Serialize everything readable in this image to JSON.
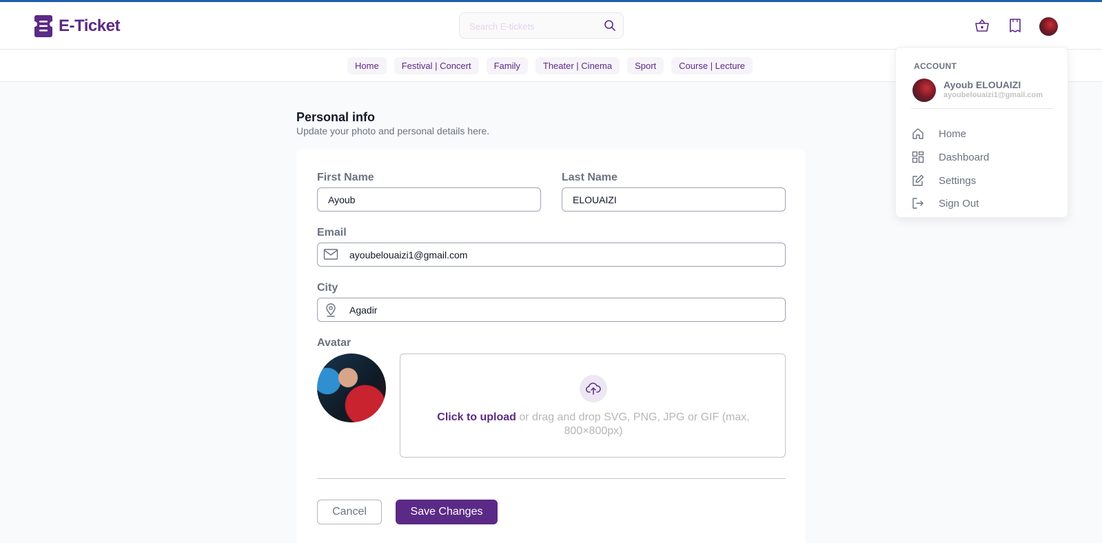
{
  "app": {
    "name": "E-Ticket",
    "accent": "#5b2a86",
    "topline": "#1f5faa"
  },
  "header": {
    "search_placeholder": "Search E-tickets",
    "icons": [
      "basket-icon",
      "ticket-icon",
      "user-avatar"
    ]
  },
  "nav": {
    "items": [
      {
        "label": "Home"
      },
      {
        "label": "Festival | Concert"
      },
      {
        "label": "Family"
      },
      {
        "label": "Theater | Cinema"
      },
      {
        "label": "Sport"
      },
      {
        "label": "Course | Lecture"
      }
    ]
  },
  "main": {
    "title": "Personal info",
    "subtitle": "Update your photo and personal details here.",
    "form": {
      "first_name_label": "First Name",
      "first_name_value": "Ayoub",
      "last_name_label": "Last Name",
      "last_name_value": "ELOUAIZI",
      "email_label": "Email",
      "email_value": "ayoubelouaizi1@gmail.com",
      "city_label": "City",
      "city_value": "Agadir",
      "avatar_label": "Avatar",
      "upload_link": "Click to upload",
      "upload_hint": " or drag and drop SVG, PNG, JPG or GIF (max, 800×800px)",
      "cancel_label": "Cancel",
      "save_label": "Save Changes"
    }
  },
  "dropdown": {
    "heading": "ACCOUNT",
    "name": "Ayoub ELOUAIZI",
    "email": "ayoubelouaizi1@gmail.com",
    "items": [
      {
        "label": "Home",
        "icon": "home-icon"
      },
      {
        "label": "Dashboard",
        "icon": "dashboard-icon"
      },
      {
        "label": "Settings",
        "icon": "edit-icon"
      },
      {
        "label": "Sign Out",
        "icon": "logout-icon"
      }
    ]
  }
}
